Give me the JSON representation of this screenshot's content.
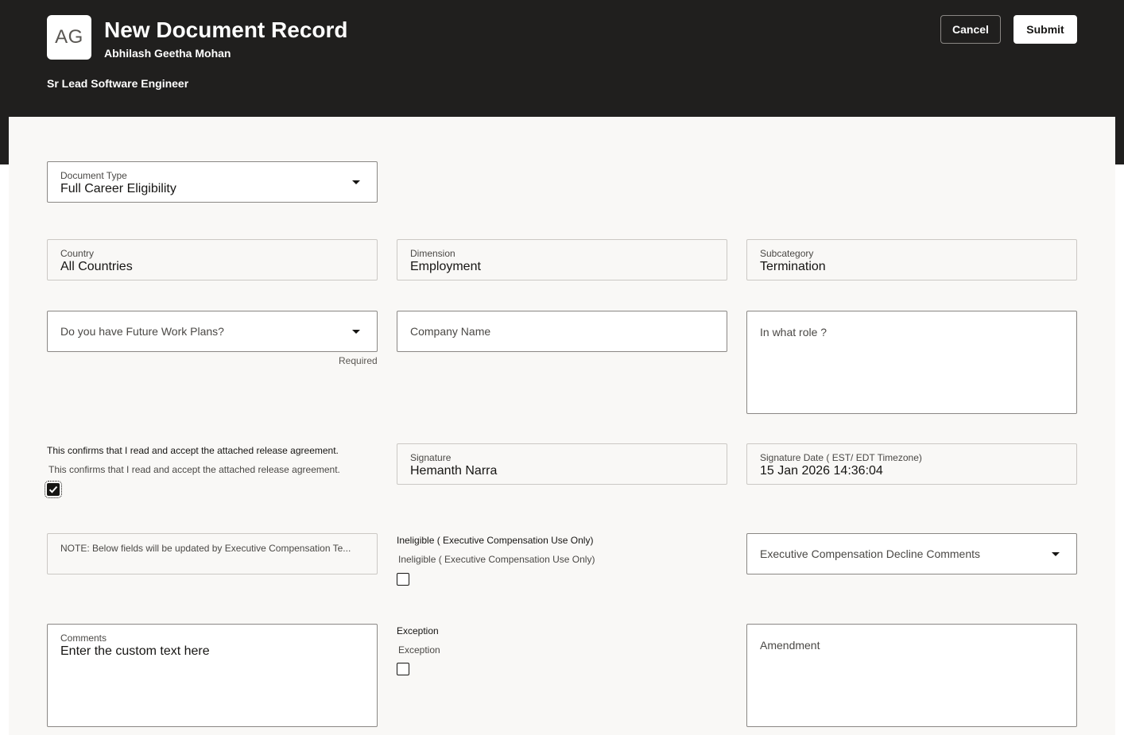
{
  "header": {
    "avatar_initials": "AG",
    "title": "New Document Record",
    "person_name": "Abhilash Geetha Mohan",
    "job_title": "Sr Lead Software Engineer",
    "cancel_label": "Cancel",
    "submit_label": "Submit"
  },
  "form": {
    "document_type": {
      "label": "Document Type",
      "value": "Full Career Eligibility"
    },
    "country": {
      "label": "Country",
      "value": "All Countries"
    },
    "dimension": {
      "label": "Dimension",
      "value": "Employment"
    },
    "subcategory": {
      "label": "Subcategory",
      "value": "Termination"
    },
    "future_work_plans": {
      "placeholder": "Do you have Future Work Plans?",
      "hint": "Required"
    },
    "company_name": {
      "placeholder": "Company Name"
    },
    "role": {
      "placeholder": "In what role ?"
    },
    "release_agreement": {
      "title": "This confirms that I read and accept the attached release agreement.",
      "label": "This confirms that I read and accept the attached release agreement.",
      "checked": true
    },
    "signature": {
      "label": "Signature",
      "value": "Hemanth Narra"
    },
    "signature_date": {
      "label": "Signature Date ( EST/ EDT Timezone)",
      "value": "15 Jan 2026 14:36:04"
    },
    "note": {
      "text": "NOTE: Below fields will be updated by Executive Compensation Te..."
    },
    "ineligible": {
      "title": "Ineligible ( Executive Compensation Use Only)",
      "label": "Ineligible ( Executive Compensation Use Only)",
      "checked": false
    },
    "decline_comments": {
      "placeholder": "Executive Compensation Decline Comments"
    },
    "comments": {
      "label": "Comments",
      "value": "Enter the custom text here"
    },
    "exception": {
      "title": "Exception",
      "label": "Exception",
      "checked": false
    },
    "amendment": {
      "placeholder": "Amendment"
    }
  },
  "colors": {
    "header_bg": "#201f1e",
    "panel_bg": "#f9f8f6"
  },
  "icons": {
    "dropdown": "chevron-down-icon",
    "check": "check-icon"
  }
}
